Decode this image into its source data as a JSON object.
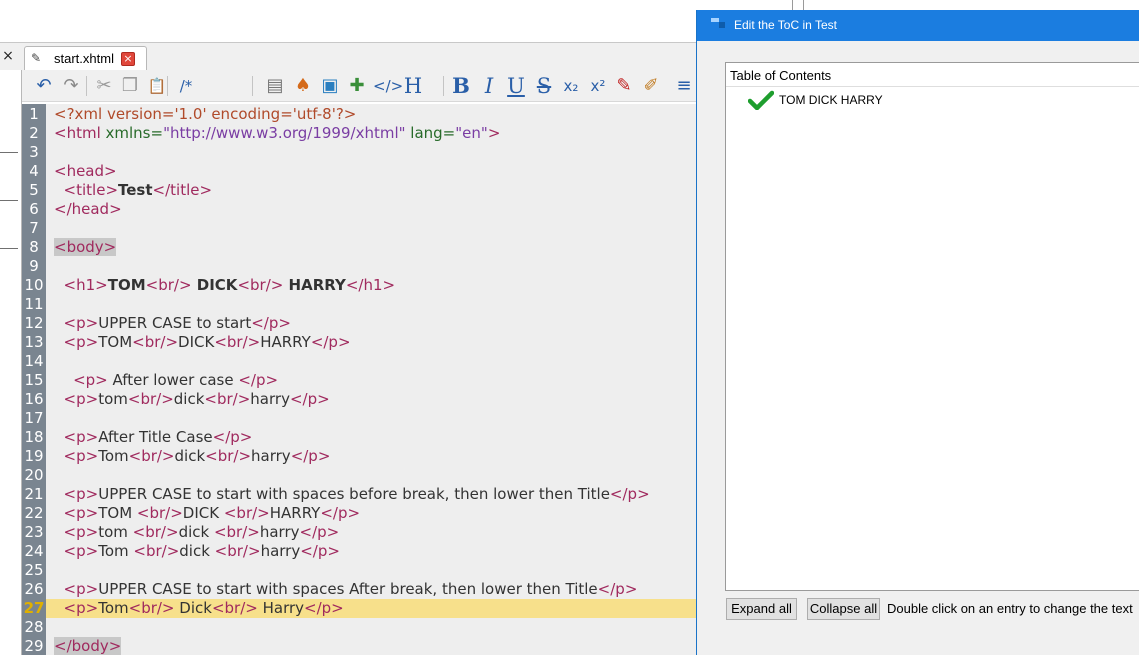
{
  "editor": {
    "tab_label": "start.xhtml",
    "tab_close": "×",
    "panel_close": "×",
    "toolbar": [
      {
        "name": "undo-icon",
        "glyph": "↶",
        "color": "#2a5fa8"
      },
      {
        "name": "redo-icon",
        "glyph": "↷",
        "color": "#8a8a8a"
      },
      {
        "name": "cut-icon",
        "glyph": "✂",
        "color": "#9a9a9a"
      },
      {
        "name": "copy-icon",
        "glyph": "❐",
        "color": "#9a9a9a"
      },
      {
        "name": "paste-icon",
        "glyph": "📋",
        "color": "#7a6a4a"
      },
      {
        "name": "comment-icon",
        "glyph": "/*",
        "color": "#2a5fa8"
      },
      {
        "name": "insert-file-icon",
        "glyph": "▤",
        "color": "#777777"
      },
      {
        "name": "insert-special-char-icon",
        "glyph": "♠",
        "color": "#d46a1a"
      },
      {
        "name": "insert-image-icon",
        "glyph": "▣",
        "color": "#2a7fc0"
      },
      {
        "name": "split-icon",
        "glyph": "✚",
        "color": "#3a8f3a"
      },
      {
        "name": "code-tag-icon",
        "glyph": "</>",
        "color": "#2a5fa8"
      },
      {
        "name": "heading-icon",
        "glyph": "H",
        "color": "#2a5fa8"
      },
      {
        "name": "bold-icon",
        "glyph": "B",
        "color": "#2a5fa8"
      },
      {
        "name": "italic-icon",
        "glyph": "I",
        "color": "#2a5fa8"
      },
      {
        "name": "underline-icon",
        "glyph": "U",
        "color": "#2a5fa8"
      },
      {
        "name": "strikethrough-icon",
        "glyph": "S",
        "color": "#2a5fa8"
      },
      {
        "name": "subscript-icon",
        "glyph": "x₂",
        "color": "#2a5fa8"
      },
      {
        "name": "superscript-icon",
        "glyph": "x²",
        "color": "#2a5fa8"
      },
      {
        "name": "paint-brush-icon",
        "glyph": "✎",
        "color": "#c02020"
      },
      {
        "name": "clear-format-icon",
        "glyph": "✐",
        "color": "#c07a20"
      },
      {
        "name": "align-left-icon",
        "glyph": "≡",
        "color": "#2a5fa8"
      }
    ],
    "current_line": 27,
    "lines": [
      [
        [
          "pi",
          "<?xml version='1.0' encoding='utf-8'?>"
        ]
      ],
      [
        [
          "tg",
          "<html "
        ],
        [
          "at",
          "xmlns="
        ],
        [
          "st",
          "\"http://www.w3.org/1999/xhtml\""
        ],
        [
          "at",
          " lang="
        ],
        [
          "st",
          "\"en\""
        ],
        [
          "tg",
          ">"
        ]
      ],
      [],
      [
        [
          "tg",
          "<head>"
        ]
      ],
      [
        [
          "t",
          "  "
        ],
        [
          "tg",
          "<title>"
        ],
        [
          "bd",
          "Test"
        ],
        [
          "tg",
          "</title>"
        ]
      ],
      [
        [
          "tg",
          "</head>"
        ]
      ],
      [],
      [
        [
          "tghl",
          "<body>"
        ]
      ],
      [],
      [
        [
          "t",
          "  "
        ],
        [
          "tg",
          "<h1>"
        ],
        [
          "bd",
          "TOM"
        ],
        [
          "tg",
          "<br/>"
        ],
        [
          "bd",
          " DICK"
        ],
        [
          "tg",
          "<br/>"
        ],
        [
          "bd",
          " HARRY"
        ],
        [
          "tg",
          "</h1>"
        ]
      ],
      [],
      [
        [
          "t",
          "  "
        ],
        [
          "tg",
          "<p>"
        ],
        [
          "t",
          "UPPER CASE to start"
        ],
        [
          "tg",
          "</p>"
        ]
      ],
      [
        [
          "t",
          "  "
        ],
        [
          "tg",
          "<p>"
        ],
        [
          "t",
          "TOM"
        ],
        [
          "tg",
          "<br/>"
        ],
        [
          "t",
          "DICK"
        ],
        [
          "tg",
          "<br/>"
        ],
        [
          "t",
          "HARRY"
        ],
        [
          "tg",
          "</p>"
        ]
      ],
      [],
      [
        [
          "t",
          "    "
        ],
        [
          "tg",
          "<p>"
        ],
        [
          "t",
          " After lower case "
        ],
        [
          "tg",
          "</p>"
        ]
      ],
      [
        [
          "t",
          "  "
        ],
        [
          "tg",
          "<p>"
        ],
        [
          "t",
          "tom"
        ],
        [
          "tg",
          "<br/>"
        ],
        [
          "t",
          "dick"
        ],
        [
          "tg",
          "<br/>"
        ],
        [
          "t",
          "harry"
        ],
        [
          "tg",
          "</p>"
        ]
      ],
      [],
      [
        [
          "t",
          "  "
        ],
        [
          "tg",
          "<p>"
        ],
        [
          "t",
          "After Title Case"
        ],
        [
          "tg",
          "</p>"
        ]
      ],
      [
        [
          "t",
          "  "
        ],
        [
          "tg",
          "<p>"
        ],
        [
          "t",
          "Tom"
        ],
        [
          "tg",
          "<br/>"
        ],
        [
          "t",
          "dick"
        ],
        [
          "tg",
          "<br/>"
        ],
        [
          "t",
          "harry"
        ],
        [
          "tg",
          "</p>"
        ]
      ],
      [],
      [
        [
          "t",
          "  "
        ],
        [
          "tg",
          "<p>"
        ],
        [
          "t",
          "UPPER CASE to start with spaces before break, then lower then Title"
        ],
        [
          "tg",
          "</p>"
        ]
      ],
      [
        [
          "t",
          "  "
        ],
        [
          "tg",
          "<p>"
        ],
        [
          "t",
          "TOM "
        ],
        [
          "tg",
          "<br/>"
        ],
        [
          "t",
          "DICK "
        ],
        [
          "tg",
          "<br/>"
        ],
        [
          "t",
          "HARRY"
        ],
        [
          "tg",
          "</p>"
        ]
      ],
      [
        [
          "t",
          "  "
        ],
        [
          "tg",
          "<p>"
        ],
        [
          "t",
          "tom "
        ],
        [
          "tg",
          "<br/>"
        ],
        [
          "t",
          "dick "
        ],
        [
          "tg",
          "<br/>"
        ],
        [
          "t",
          "harry"
        ],
        [
          "tg",
          "</p>"
        ]
      ],
      [
        [
          "t",
          "  "
        ],
        [
          "tg",
          "<p>"
        ],
        [
          "t",
          "Tom "
        ],
        [
          "tg",
          "<br/>"
        ],
        [
          "t",
          "dick "
        ],
        [
          "tg",
          "<br/>"
        ],
        [
          "t",
          "harry"
        ],
        [
          "tg",
          "</p>"
        ]
      ],
      [],
      [
        [
          "t",
          "  "
        ],
        [
          "tg",
          "<p>"
        ],
        [
          "t",
          "UPPER CASE to start with spaces After break, then lower then Title"
        ],
        [
          "tg",
          "</p>"
        ]
      ],
      [
        [
          "t",
          "  "
        ],
        [
          "tg",
          "<p>"
        ],
        [
          "t",
          "Tom"
        ],
        [
          "tg",
          "<br/>"
        ],
        [
          "t",
          " Dick"
        ],
        [
          "tg",
          "<br/>"
        ],
        [
          "t",
          " Harry"
        ],
        [
          "tg",
          "</p>"
        ]
      ],
      [],
      [
        [
          "tghl",
          "</body>"
        ]
      ]
    ]
  },
  "dialog": {
    "title": "Edit the ToC in Test",
    "tree_header": "Table of Contents",
    "entries": [
      {
        "text": "TOM DICK HARRY",
        "icon": "check-icon"
      }
    ],
    "expand_label": "Expand all",
    "collapse_label": "Collapse all",
    "hint": "Double click on an entry to change the text"
  },
  "colors": {
    "title_bar": "#1b7de0",
    "gutter": "#7a8590",
    "current_line_highlight": "#f7e08b",
    "tag": "#a02a5e",
    "attribute": "#286b2a",
    "string": "#7a3da3",
    "check": "#1e9e2e"
  }
}
